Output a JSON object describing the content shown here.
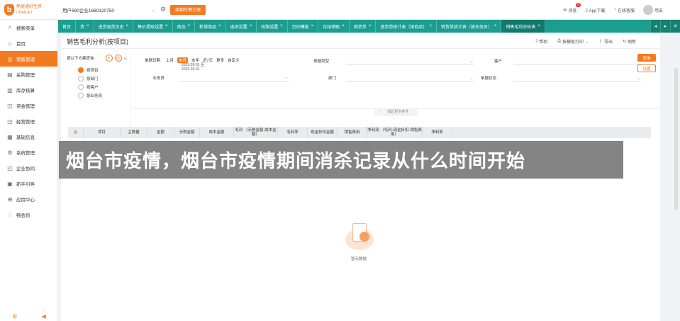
{
  "app": {
    "logo_letter": "b",
    "logo_line1": "畅捷通好生意",
    "logo_line2": "CHANJET"
  },
  "topbar": {
    "account": "用户690企业1660120750",
    "pay_label": "续期付费方案",
    "message_label": "消息",
    "message_count": "6",
    "app_label": "App下载",
    "service_label": "在线客服",
    "user_label": "用友"
  },
  "sidebar": {
    "items": [
      {
        "label": "搜索菜单",
        "icon": "search-icon",
        "glyph": "⌕"
      },
      {
        "label": "首页",
        "icon": "home-icon",
        "glyph": "⌂"
      },
      {
        "label": "销售管理",
        "icon": "sales-icon",
        "glyph": "◎"
      },
      {
        "label": "采购管理",
        "icon": "purchase-icon",
        "glyph": "▤"
      },
      {
        "label": "库存核算",
        "icon": "inventory-icon",
        "glyph": "▥"
      },
      {
        "label": "资金管理",
        "icon": "funds-icon",
        "glyph": "◫"
      },
      {
        "label": "经营管理",
        "icon": "business-icon",
        "glyph": "◳"
      },
      {
        "label": "基础信息",
        "icon": "basic-info-icon",
        "glyph": "▦"
      },
      {
        "label": "系统管理",
        "icon": "system-icon",
        "glyph": "⚙"
      },
      {
        "label": "企业协同",
        "icon": "collab-icon",
        "glyph": "◰"
      },
      {
        "label": "新手引导",
        "icon": "guide-icon",
        "glyph": "▣"
      },
      {
        "label": "应用中心",
        "icon": "apps-icon",
        "glyph": "⊞"
      },
      {
        "label": "畅会员",
        "icon": "member-icon",
        "glyph": "♢"
      }
    ],
    "active_index": 2
  },
  "tabs": [
    {
      "label": "首页",
      "closable": false
    },
    {
      "label": "货",
      "closable": true
    },
    {
      "label": "进货退货历史",
      "closable": true
    },
    {
      "label": "售价提取设置",
      "closable": true
    },
    {
      "label": "商品",
      "closable": true
    },
    {
      "label": "新增商品",
      "closable": true
    },
    {
      "label": "选项设置",
      "closable": true
    },
    {
      "label": "权限设置",
      "closable": true
    },
    {
      "label": "打印模板",
      "closable": true
    },
    {
      "label": "月结销账",
      "closable": true
    },
    {
      "label": "销货单",
      "closable": true
    },
    {
      "label": "进货单统计表（按商品）",
      "closable": true
    },
    {
      "label": "销货单统计表（按业务员）",
      "closable": true
    },
    {
      "label": "销售毛利分析表",
      "closable": true,
      "active": true
    }
  ],
  "page": {
    "title": "销售毛利分析(按项目)",
    "help_label": "帮助",
    "print_label": "按模板打印",
    "export_label": "导出",
    "refresh_label": "刷新"
  },
  "scheme": {
    "title": "按以下方案查询",
    "items": [
      {
        "label": "按项目",
        "active": true
      },
      {
        "label": "按部门",
        "active": false
      },
      {
        "label": "按客户",
        "active": false
      },
      {
        "label": "按业务员",
        "active": false
      }
    ]
  },
  "filters": {
    "date_label": "单据日期",
    "date_options": [
      "上月",
      "本月",
      "本年",
      "近7天",
      "更多",
      "自定义"
    ],
    "date_selected": "本月",
    "date_from": "2023-03-01 至",
    "date_to": "2023-03-31",
    "doc_type_label": "单据类型",
    "customer_label": "客户",
    "salesman_label": "业务员",
    "dept_label": "部门",
    "status_label": "单据状态",
    "query_label": "查询",
    "reset_label": "设置",
    "more_label": "收起更多条件"
  },
  "table": {
    "columns": [
      {
        "label": "◎",
        "w": 22
      },
      {
        "label": "项目",
        "w": 52
      },
      {
        "label": "主数量",
        "w": 38
      },
      {
        "label": "金额",
        "w": 38
      },
      {
        "label": "无税金额",
        "w": 36
      },
      {
        "label": "成本金额",
        "w": 48
      },
      {
        "label": "毛利 （无税金额-成本金额）",
        "w": 62
      },
      {
        "label": "毛利率",
        "w": 42
      },
      {
        "label": "现金折扣金额",
        "w": 42
      },
      {
        "label": "销售费用",
        "w": 42
      },
      {
        "label": "净利润 （毛利-现金折扣-销售费用）",
        "w": 78
      },
      {
        "label": "净利率",
        "w": 42
      }
    ]
  },
  "empty_text": "暂无数据",
  "overlay_text": "烟台市疫情，烟台市疫情期间消杀记录从什么时间开始"
}
